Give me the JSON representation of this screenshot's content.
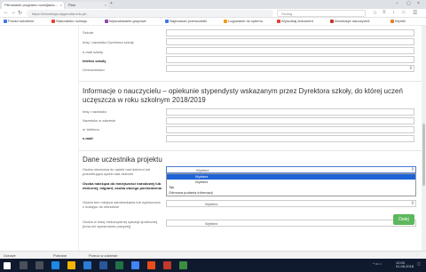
{
  "browser": {
    "tabs": [
      {
        "title": "Filtrowanie programu rozwijania..."
      },
      {
        "title": "Plan"
      }
    ],
    "url": "https://rekrutacja-stypendia.edu.pl/...",
    "search_placeholder": "Szukaj"
  },
  "bookmarks": [
    {
      "label": "Ponad szkolenie",
      "color": "#3b78e7"
    },
    {
      "label": "Stanowisko rozwoju",
      "color": "#e34234"
    },
    {
      "label": "Wyszukiwanie grupowe",
      "color": "#8e44ad"
    },
    {
      "label": "Najnowsze przewodniki",
      "color": "#3b78e7"
    },
    {
      "label": "Logowanie do sytemu",
      "color": "#f39c12"
    },
    {
      "label": "Wyszukaj dokument",
      "color": "#e34234"
    },
    {
      "label": "Informacje nauczycieli",
      "color": "#c0392b"
    },
    {
      "label": "Wyniki",
      "color": "#e67e22"
    }
  ],
  "form_top": {
    "labels": [
      "Szkoła",
      "Imię i nazwisko Dyrektora szkoły",
      "e-mail szkoły",
      "telefon szkoły",
      "Gmina/miasto"
    ]
  },
  "section2": {
    "title": "Informacje o nauczycielu – opiekunie stypendysty wskazanym przez Dyrektora szkoły, do której uczeń uczęszcza w roku szkolnym 2018/2019",
    "labels": [
      "Imię i nazwisko",
      "Nazwisko w zakresie",
      "nr telefonu",
      "e-mail"
    ]
  },
  "section3": {
    "title": "Dane uczestnika projektu",
    "questions": [
      "Osoba niezdolna do opieki nad dziećmi lub potrzebująca opieki nad dziećmi",
      "Osoba należąca do mniejszości narodowej lub etnicznej, migrant, osoba obcego pochodzenia",
      "Osoba bez miejsca zamieszkania lub wykluczona z dostępu do mieszkań",
      "Osoba w innej niekorzystnej sytuacji społecznej (inna niż wymienione powyżej)"
    ],
    "select_value": "Wybierz",
    "dropdown_options": [
      "Wybierz",
      "Wybierz",
      "Tak",
      "Odmowa podania informacji"
    ]
  },
  "next_button": "Dalej",
  "status": {
    "left": "Gotowe",
    "items": [
      "Pobrane",
      "Pomoc w zakresie"
    ]
  },
  "tray": {
    "time": "12:00",
    "date": "01.06.2018"
  }
}
